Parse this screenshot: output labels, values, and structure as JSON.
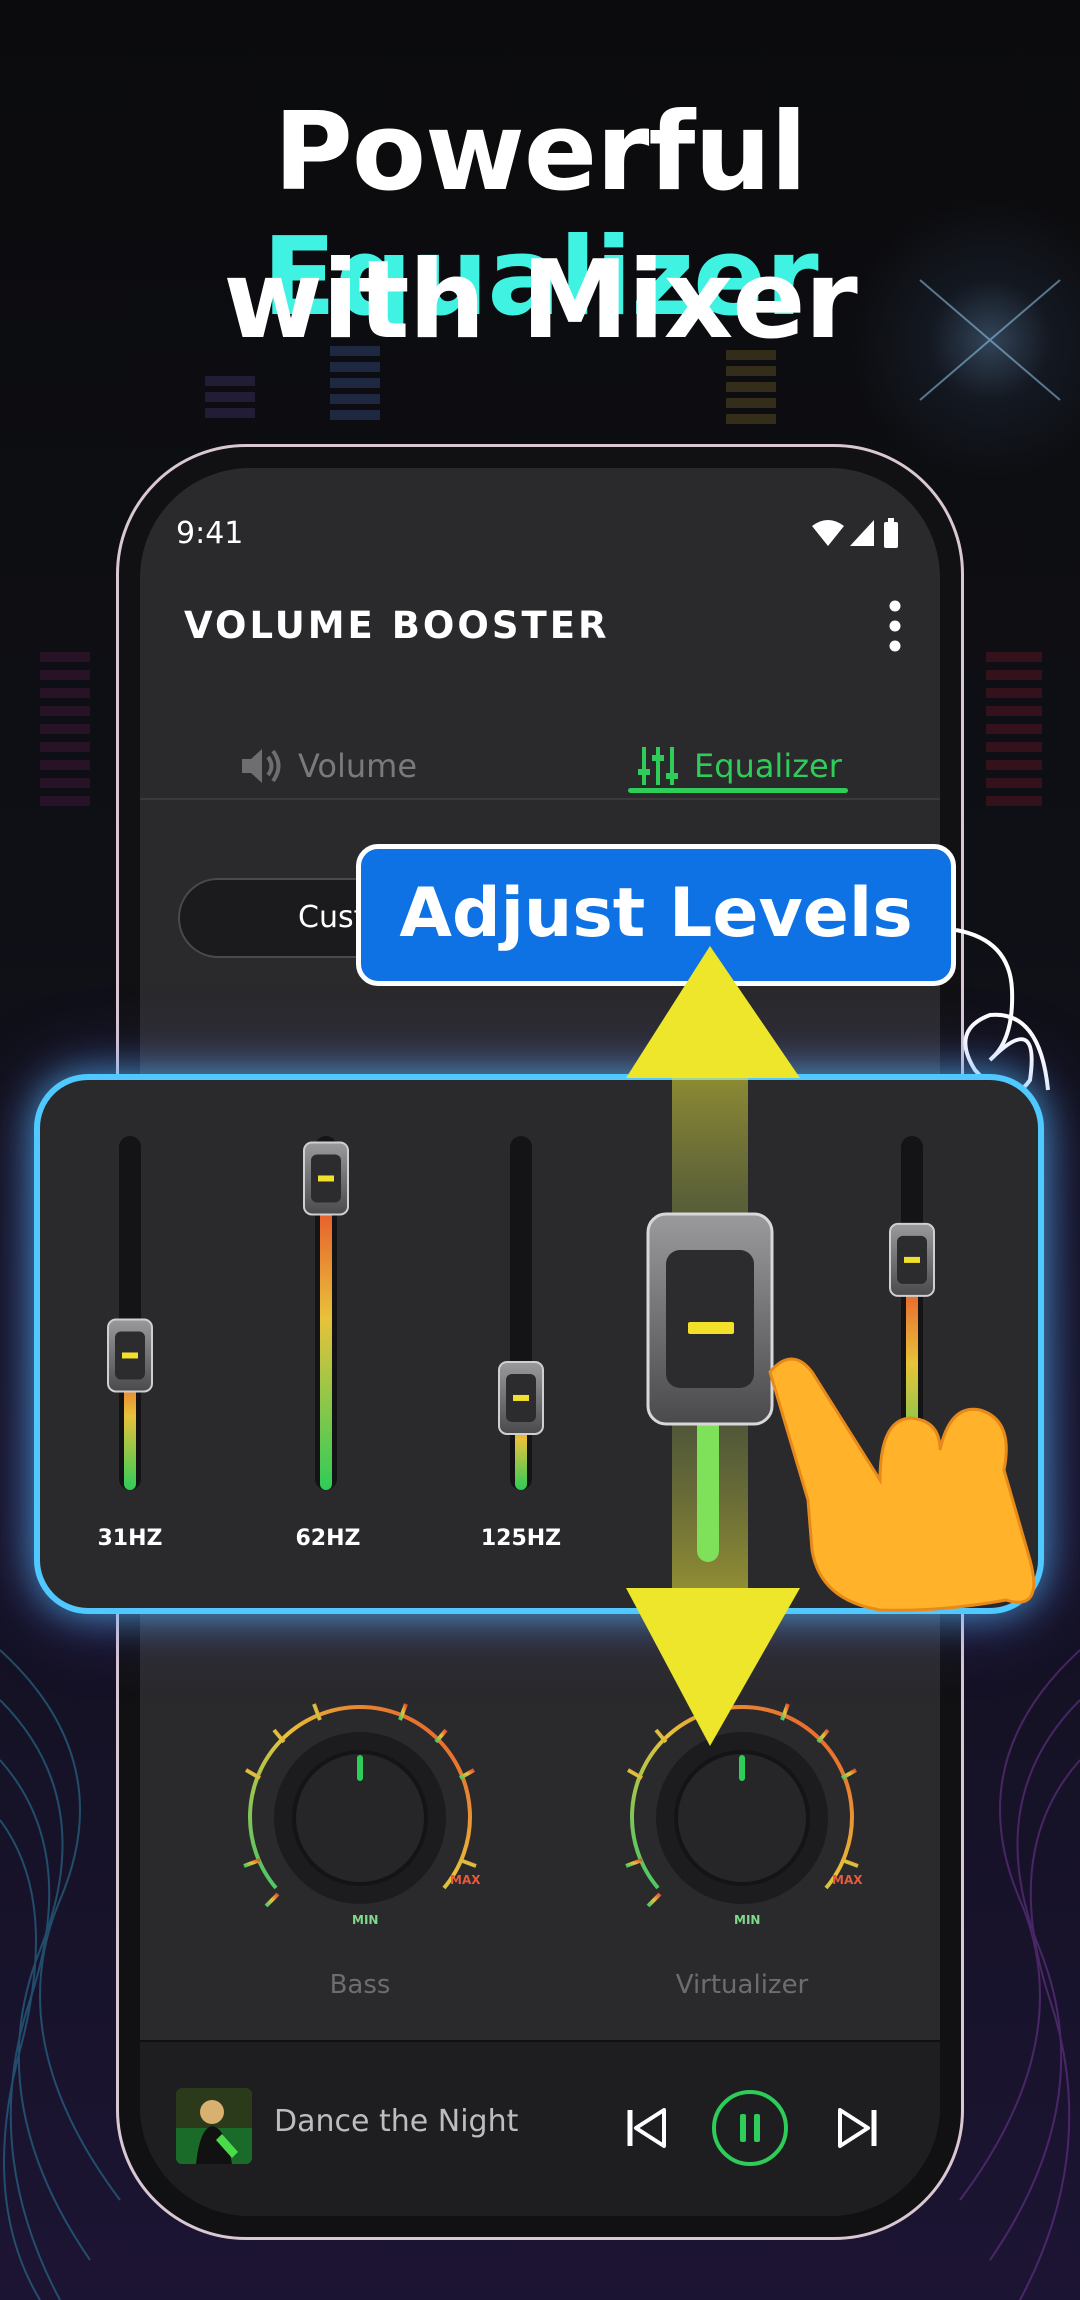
{
  "headline": {
    "line1_prefix": "Powerful ",
    "line1_accent": "Equalizer",
    "line2": "with Mixer",
    "accent_color": "#3ff2e2"
  },
  "status_bar": {
    "time": "9:41",
    "icons": [
      "wifi-icon",
      "signal-icon",
      "battery-icon"
    ]
  },
  "app": {
    "title": "VOLUME BOOSTER",
    "menu_icon": "more-vert-icon"
  },
  "tabs": [
    {
      "label": "Volume",
      "icon": "speaker-icon",
      "active": false
    },
    {
      "label": "Equalizer",
      "icon": "equalizer-icon",
      "active": true
    }
  ],
  "accent_green": "#2ecc58",
  "preset": {
    "label": "Cust"
  },
  "callout": {
    "text": "Adjust Levels"
  },
  "equalizer": {
    "bands": [
      {
        "label": "31HZ",
        "level": 0.38
      },
      {
        "label": "62HZ",
        "level": 0.88
      },
      {
        "label": "125HZ",
        "level": 0.26
      },
      {
        "label": "",
        "level": 0.6
      },
      {
        "label": "",
        "level": 0.65
      }
    ]
  },
  "knobs": [
    {
      "label": "Bass",
      "min_label": "MIN",
      "max_label": "MAX"
    },
    {
      "label": "Virtualizer",
      "min_label": "MIN",
      "max_label": "MAX"
    }
  ],
  "player": {
    "track": "Dance the Night",
    "controls": [
      "previous-icon",
      "pause-icon",
      "next-icon"
    ]
  }
}
